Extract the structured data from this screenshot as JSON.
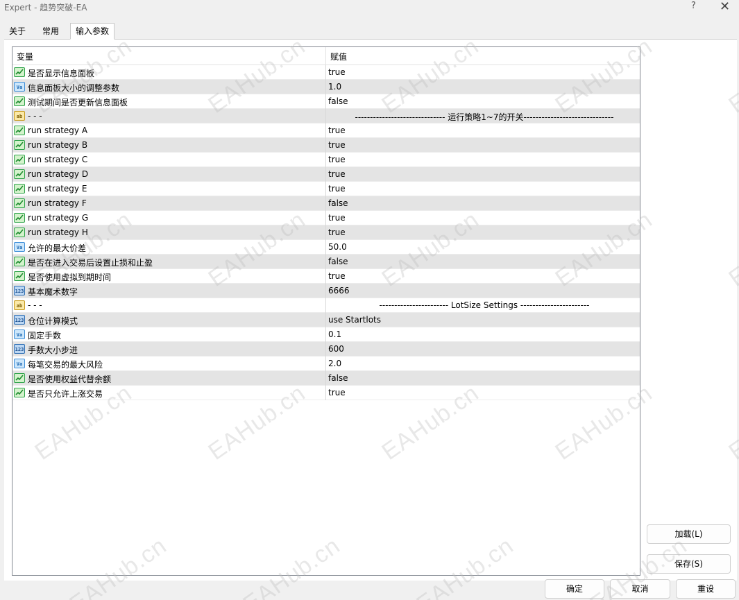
{
  "window": {
    "title": "Expert - 趋势突破-EA",
    "help": "?",
    "close": "✕"
  },
  "tabs": [
    {
      "label": "关于"
    },
    {
      "label": "常用"
    },
    {
      "label": "输入参数"
    }
  ],
  "table": {
    "headers": {
      "variable": "变量",
      "value": "赋值"
    },
    "rows": [
      {
        "icon": "bool",
        "name": "是否显示信息面板",
        "value": "true"
      },
      {
        "icon": "dbl",
        "name": "信息面板大小的调整参数",
        "value": "1.0"
      },
      {
        "icon": "bool",
        "name": "测试期间是否更新信息面板",
        "value": "false"
      },
      {
        "icon": "str",
        "name": "- - -",
        "value": "------------------------------ 运行策略1~7的开关------------------------------"
      },
      {
        "icon": "bool",
        "name": "run strategy A",
        "value": "true"
      },
      {
        "icon": "bool",
        "name": "run strategy B",
        "value": "true"
      },
      {
        "icon": "bool",
        "name": "run strategy C",
        "value": "true"
      },
      {
        "icon": "bool",
        "name": "run strategy D",
        "value": "true"
      },
      {
        "icon": "bool",
        "name": "run strategy E",
        "value": "true"
      },
      {
        "icon": "bool",
        "name": "run strategy F",
        "value": "false"
      },
      {
        "icon": "bool",
        "name": "run strategy G",
        "value": "true"
      },
      {
        "icon": "bool",
        "name": "run strategy H",
        "value": "true"
      },
      {
        "icon": "dbl",
        "name": "允许的最大价差",
        "value": "50.0"
      },
      {
        "icon": "bool",
        "name": "是否在进入交易后设置止损和止盈",
        "value": "false"
      },
      {
        "icon": "bool",
        "name": "是否使用虚拟到期时间",
        "value": "true"
      },
      {
        "icon": "int",
        "name": "基本魔术数字",
        "value": "6666"
      },
      {
        "icon": "str",
        "name": "- - -",
        "value": "----------------------- LotSize Settings -----------------------"
      },
      {
        "icon": "int",
        "name": "仓位计算模式",
        "value": "use Startlots"
      },
      {
        "icon": "dbl",
        "name": "固定手数",
        "value": "0.1"
      },
      {
        "icon": "int",
        "name": "手数大小步进",
        "value": "600"
      },
      {
        "icon": "dbl",
        "name": "每笔交易的最大风险",
        "value": "2.0"
      },
      {
        "icon": "bool",
        "name": "是否使用权益代替余额",
        "value": "false"
      },
      {
        "icon": "bool",
        "name": "是否只允许上涨交易",
        "value": "true"
      }
    ]
  },
  "icon_names": {
    "bool": "bool-param-icon",
    "dbl": "double-param-icon",
    "int": "integer-param-icon",
    "str": "string-param-icon"
  },
  "icon_glyphs": {
    "bool": "",
    "dbl": "Va",
    "int": "123",
    "str": "ab"
  },
  "buttons": {
    "load": "加载(L)",
    "save": "保存(S)",
    "ok": "确定",
    "cancel": "取消",
    "reset": "重设"
  },
  "watermark": "EAHub.cn"
}
